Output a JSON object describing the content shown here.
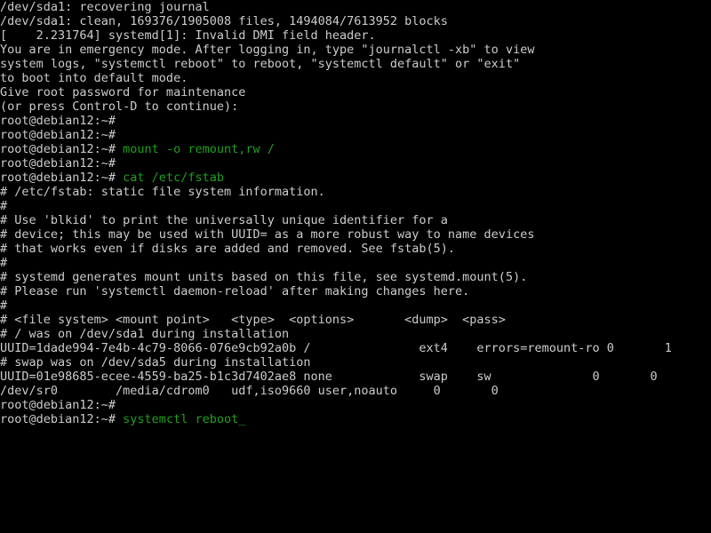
{
  "terminal": {
    "title": "Debian 12 emergency mode console",
    "hostname": "debian12",
    "user": "root",
    "prompt": "root@debian12:~# ",
    "colors": {
      "background": "#000000",
      "foreground": "#cccccc",
      "command_green": "#1ea01e",
      "cursor": "#1ea01e"
    },
    "cursor": {
      "glyph": "_",
      "visible": true
    },
    "lines": [
      {
        "type": "output",
        "text": "/dev/sda1: recovering journal"
      },
      {
        "type": "output",
        "text": "/dev/sda1: clean, 169376/1905008 files, 1494084/7613952 blocks"
      },
      {
        "type": "output",
        "text": "[    2.231764] systemd[1]: Invalid DMI field header."
      },
      {
        "type": "output",
        "text": "You are in emergency mode. After logging in, type \"journalctl -xb\" to view"
      },
      {
        "type": "output",
        "text": "system logs, \"systemctl reboot\" to reboot, \"systemctl default\" or \"exit\""
      },
      {
        "type": "output",
        "text": "to boot into default mode."
      },
      {
        "type": "output",
        "text": "Give root password for maintenance"
      },
      {
        "type": "output",
        "text": "(or press Control-D to continue):"
      },
      {
        "type": "prompt",
        "command": ""
      },
      {
        "type": "prompt",
        "command": ""
      },
      {
        "type": "prompt",
        "command": "mount -o remount,rw /"
      },
      {
        "type": "prompt",
        "command": ""
      },
      {
        "type": "prompt",
        "command": "cat /etc/fstab"
      },
      {
        "type": "output",
        "text": "# /etc/fstab: static file system information."
      },
      {
        "type": "output",
        "text": "#"
      },
      {
        "type": "output",
        "text": "# Use 'blkid' to print the universally unique identifier for a"
      },
      {
        "type": "output",
        "text": "# device; this may be used with UUID= as a more robust way to name devices"
      },
      {
        "type": "output",
        "text": "# that works even if disks are added and removed. See fstab(5)."
      },
      {
        "type": "output",
        "text": "#"
      },
      {
        "type": "output",
        "text": "# systemd generates mount units based on this file, see systemd.mount(5)."
      },
      {
        "type": "output",
        "text": "# Please run 'systemctl daemon-reload' after making changes here."
      },
      {
        "type": "output",
        "text": "#"
      },
      {
        "type": "output",
        "text": "# <file system> <mount point>   <type>  <options>       <dump>  <pass>"
      },
      {
        "type": "output",
        "text": "# / was on /dev/sda1 during installation"
      },
      {
        "type": "output",
        "text": "UUID=1dade994-7e4b-4c79-8066-076e9cb92a0b /               ext4    errors=remount-ro 0       1"
      },
      {
        "type": "output",
        "text": "# swap was on /dev/sda5 during installation"
      },
      {
        "type": "output",
        "text": "UUID=01e98685-ecee-4559-ba25-b1c3d7402ae8 none            swap    sw              0       0"
      },
      {
        "type": "output",
        "text": "/dev/sr0        /media/cdrom0   udf,iso9660 user,noauto     0       0"
      },
      {
        "type": "prompt",
        "command": ""
      },
      {
        "type": "prompt",
        "command": "systemctl reboot",
        "cursor": true
      }
    ],
    "fstab": {
      "headers": [
        "<file system>",
        "<mount point>",
        "<type>",
        "<options>",
        "<dump>",
        "<pass>"
      ],
      "entries": [
        {
          "comment": "# / was on /dev/sda1 during installation",
          "file_system": "UUID=1dade994-7e4b-4c79-8066-076e9cb92a0b",
          "mount_point": "/",
          "type": "ext4",
          "options": "errors=remount-ro",
          "dump": "0",
          "pass": "1"
        },
        {
          "comment": "# swap was on /dev/sda5 during installation",
          "file_system": "UUID=01e98685-ecee-4559-ba25-b1c3d7402ae8",
          "mount_point": "none",
          "type": "swap",
          "options": "sw",
          "dump": "0",
          "pass": "0"
        },
        {
          "comment": "",
          "file_system": "/dev/sr0",
          "mount_point": "/media/cdrom0",
          "type": "udf,iso9660",
          "options": "user,noauto",
          "dump": "0",
          "pass": "0"
        }
      ]
    },
    "boot_info": {
      "journal_recovery": "/dev/sda1: recovering journal",
      "fsck_result": "/dev/sda1: clean, 169376/1905008 files, 1494084/7613952 blocks",
      "files_used": "169376",
      "files_total": "1905008",
      "blocks_used": "1494084",
      "blocks_total": "7613952",
      "kernel_timestamp": "2.231764",
      "kernel_message": "systemd[1]: Invalid DMI field header."
    }
  }
}
